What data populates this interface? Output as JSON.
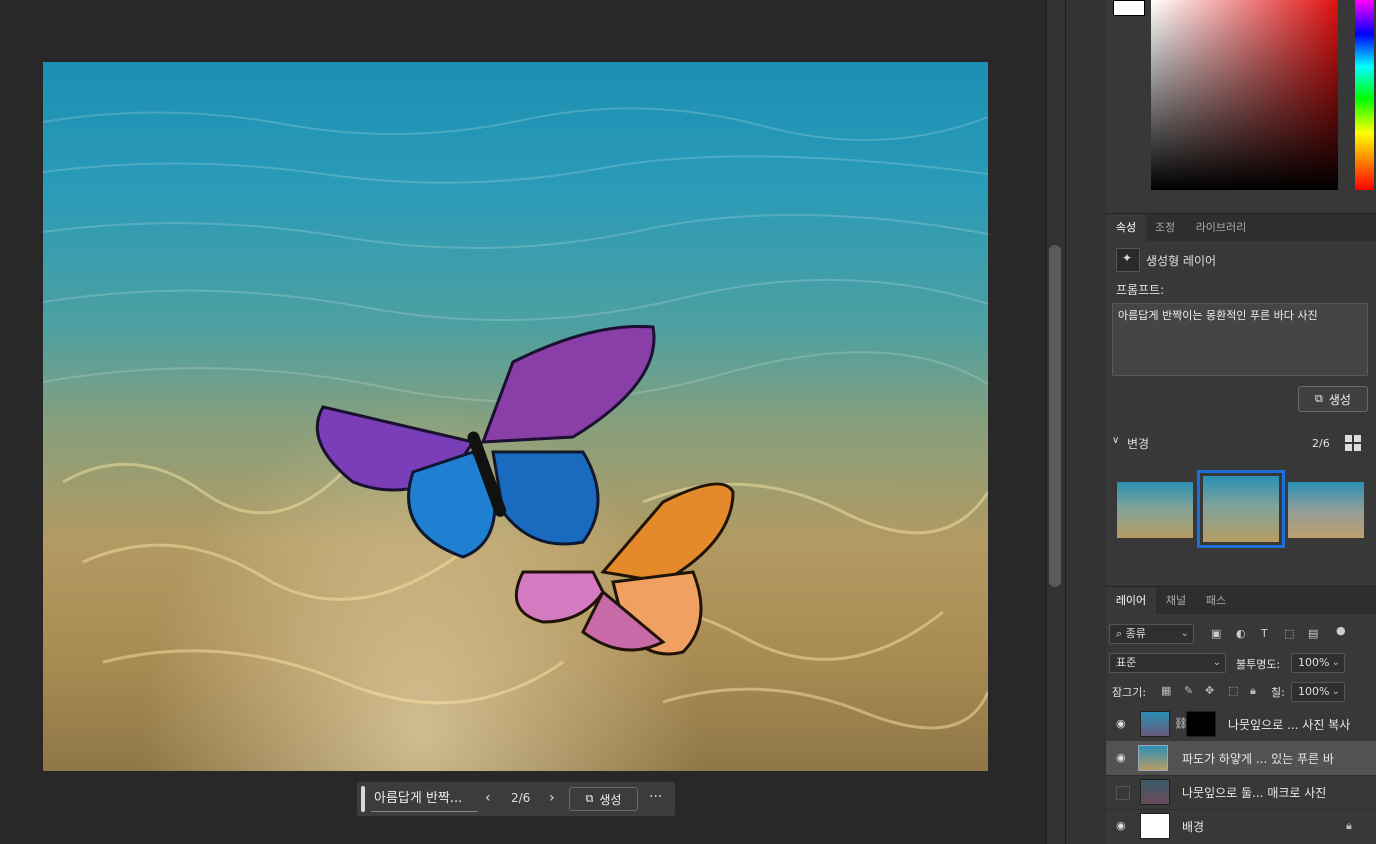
{
  "panel": {
    "tabs": [
      "속성",
      "조정",
      "라이브러리"
    ],
    "layer_type": "생성형 레이어",
    "prompt_label": "프롬프트:",
    "prompt_text": "아름답게 반짝이는 몽환적인 푸른 바다 사진",
    "generate_label": "생성",
    "variations_label": "변경",
    "variations_counter": "2/6"
  },
  "layers_panel": {
    "tabs": [
      "레이어",
      "채널",
      "패스"
    ],
    "filter_kind": "종류",
    "blend_mode": "표준",
    "opacity_label": "불투명도:",
    "opacity_value": "100%",
    "lock_label": "잠그기:",
    "fill_label": "칠:",
    "fill_value": "100%",
    "layers": [
      {
        "name": "나뭇잎으로 ... 사진 복사",
        "visible": true,
        "selected": false
      },
      {
        "name": "파도가 하얗게 ... 있는 푸른 바",
        "visible": true,
        "selected": true
      },
      {
        "name": "나뭇잎으로 둘... 매크로 사진",
        "visible": false,
        "selected": false
      },
      {
        "name": "배경",
        "visible": true,
        "selected": false
      }
    ]
  },
  "context_bar": {
    "prompt_preview": "아름답게 반짝...",
    "counter": "2/6",
    "generate_label": "생성",
    "more": "···"
  },
  "colors": {
    "selection_blue": "#1f6fd8",
    "panel_bg": "#383838",
    "canvas_bg": "#282828"
  }
}
